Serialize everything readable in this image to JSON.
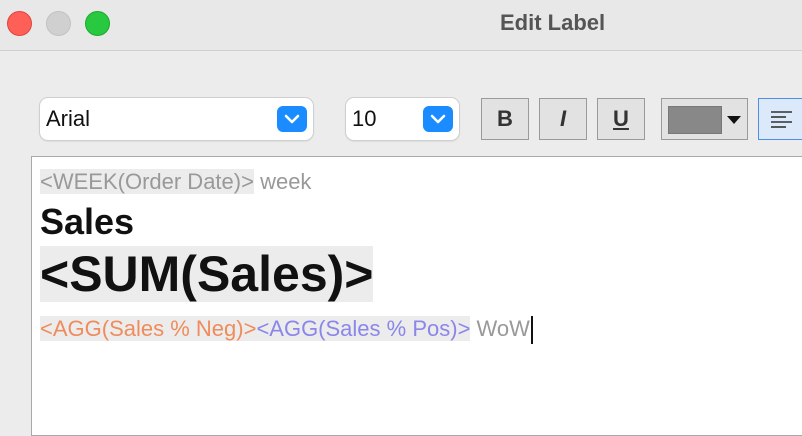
{
  "window": {
    "title": "Edit Label"
  },
  "toolbar": {
    "font": "Arial",
    "size": "10",
    "bold_label": "B",
    "italic_label": "I",
    "underline_label": "U",
    "text_color": "#888888"
  },
  "editor": {
    "line1_field": "<WEEK(Order Date)>",
    "line1_text": " week",
    "line2_text": "Sales",
    "line3_field": "<SUM(Sales)>",
    "line4_neg_field": "<AGG(Sales % Neg)>",
    "line4_pos_field": "<AGG(Sales % Pos)>",
    "line4_text": " WoW"
  }
}
